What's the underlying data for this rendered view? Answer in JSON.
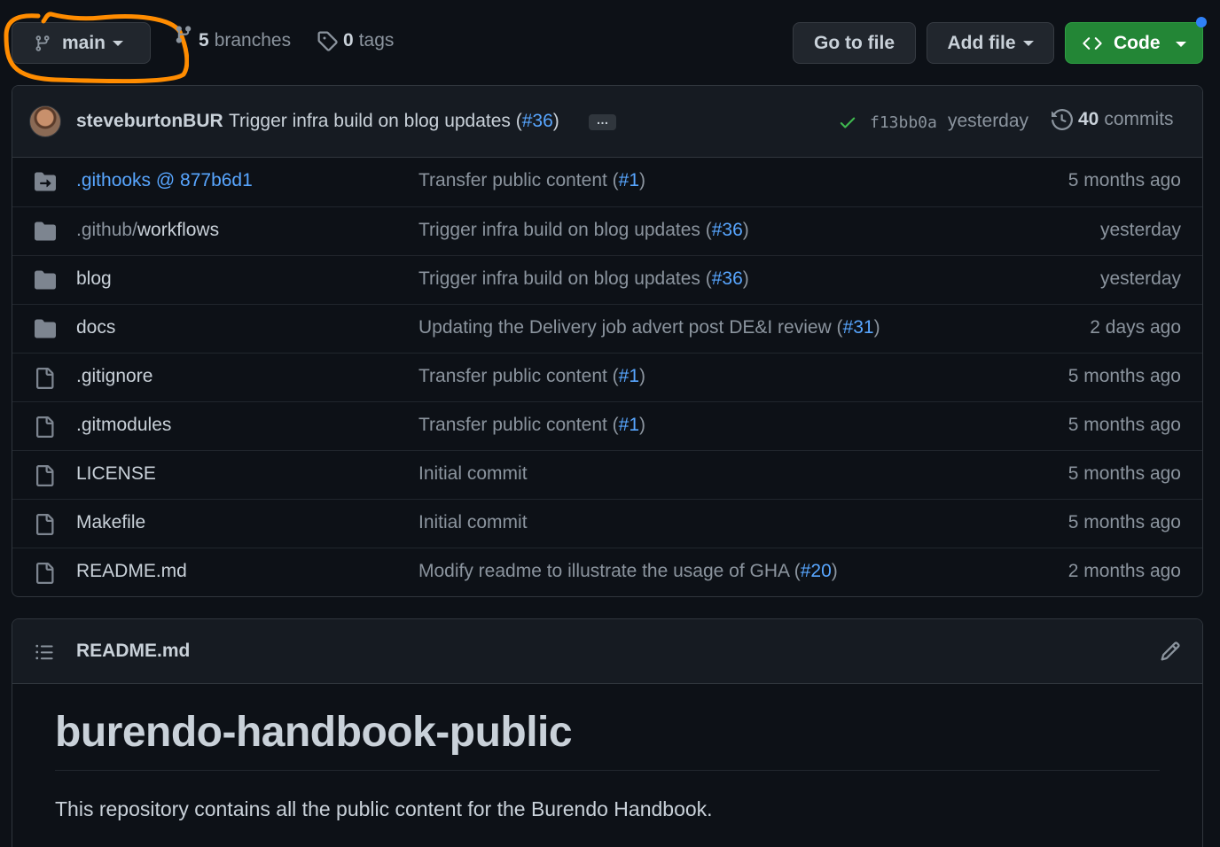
{
  "topbar": {
    "branch": "main",
    "branches_count": "5",
    "branches_label": "branches",
    "tags_count": "0",
    "tags_label": "tags",
    "goto_file": "Go to file",
    "add_file": "Add file",
    "code": "Code"
  },
  "commit": {
    "author": "steveburtonBUR",
    "message": "Trigger infra build on blog updates (",
    "pr": "#36",
    "message_end": ")",
    "ellipsis": "…",
    "sha": "f13bb0a",
    "time": "yesterday",
    "commits_count": "40",
    "commits_label": "commits"
  },
  "files": [
    {
      "name": ".githooks @ 877b6d1",
      "type": "submodule",
      "msg": "Transfer public content (",
      "pr": "#1",
      "msg_end": ")",
      "age": "5 months ago"
    },
    {
      "name_dim": ".github/",
      "name": "workflows",
      "type": "folder",
      "msg": "Trigger infra build on blog updates (",
      "pr": "#36",
      "msg_end": ")",
      "age": "yesterday"
    },
    {
      "name": "blog",
      "type": "folder",
      "msg": "Trigger infra build on blog updates (",
      "pr": "#36",
      "msg_end": ")",
      "age": "yesterday"
    },
    {
      "name": "docs",
      "type": "folder",
      "msg": "Updating the Delivery job advert post DE&I review (",
      "pr": "#31",
      "msg_end": ")",
      "age": "2 days ago"
    },
    {
      "name": ".gitignore",
      "type": "file",
      "msg": "Transfer public content (",
      "pr": "#1",
      "msg_end": ")",
      "age": "5 months ago"
    },
    {
      "name": ".gitmodules",
      "type": "file",
      "msg": "Transfer public content (",
      "pr": "#1",
      "msg_end": ")",
      "age": "5 months ago"
    },
    {
      "name": "LICENSE",
      "type": "file",
      "msg": "Initial commit",
      "pr": "",
      "msg_end": "",
      "age": "5 months ago"
    },
    {
      "name": "Makefile",
      "type": "file",
      "msg": "Initial commit",
      "pr": "",
      "msg_end": "",
      "age": "5 months ago"
    },
    {
      "name": "README.md",
      "type": "file",
      "msg": "Modify readme to illustrate the usage of GHA (",
      "pr": "#20",
      "msg_end": ")",
      "age": "2 months ago"
    }
  ],
  "readme": {
    "label": "README.md",
    "title": "burendo-handbook-public",
    "description": "This repository contains all the public content for the Burendo Handbook."
  },
  "colors": {
    "background": "#0d1117",
    "link": "#58a6ff",
    "code_button": "#238636",
    "highlight_annotation": "#ff8c00",
    "check": "#3fb950"
  }
}
